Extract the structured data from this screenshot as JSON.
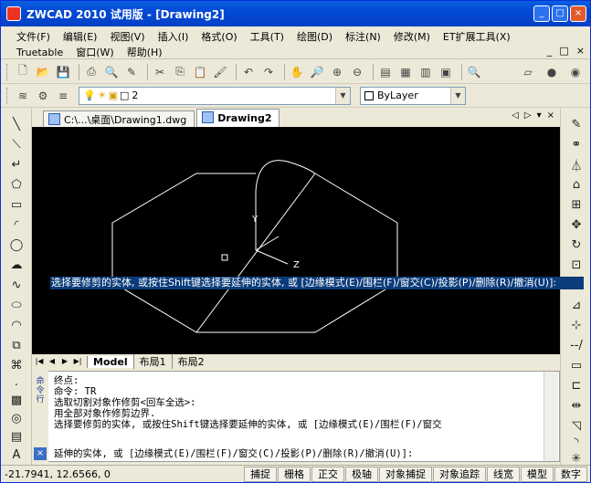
{
  "window": {
    "title": "ZWCAD 2010 试用版 - [Drawing2]"
  },
  "menu": {
    "row1": [
      "文件(F)",
      "编辑(E)",
      "视图(V)",
      "插入(I)",
      "格式(O)",
      "工具(T)",
      "绘图(D)",
      "标注(N)",
      "修改(M)",
      "ET扩展工具(X)"
    ],
    "row2": [
      "Truetable",
      "窗口(W)",
      "帮助(H)"
    ],
    "doc_controls": [
      "_",
      "□",
      "×"
    ]
  },
  "toolbar": {
    "layer_value": "2",
    "linetype_value": "ByLayer"
  },
  "doc_tabs": [
    {
      "label": "C:\\...\\桌面\\Drawing1.dwg",
      "active": false
    },
    {
      "label": "Drawing2",
      "active": true
    }
  ],
  "doc_tab_controls": [
    "◁",
    "▷",
    "▾",
    "×"
  ],
  "canvas": {
    "prompt_highlight": "选择要修剪的实体, 或按住Shift键选择要延伸的实体, 或 [边缘模式(E)/围栏(F)/窗交(C)/投影(P)/删除(R)/撤消(U)]:",
    "axis_labels": {
      "y": "Y",
      "z": "Z"
    }
  },
  "layout_tabs": {
    "nav": [
      "|◀",
      "◀",
      "▶",
      "▶|"
    ],
    "tabs": [
      "Model",
      "布局1",
      "布局2"
    ]
  },
  "command": {
    "side_label": "命令行",
    "lines": [
      "终点:",
      "命令: TR",
      "选取切割对象作修剪<回车全选>:",
      "用全部对象作修剪边界.",
      "选择要修剪的实体, 或按住Shift键选择要延伸的实体, 或 [边缘模式(E)/围栏(F)/窗交"
    ],
    "input_line": "延伸的实体, 或 [边缘模式(E)/围栏(F)/窗交(C)/投影(P)/删除(R)/撤消(U)]:"
  },
  "status": {
    "coords": "-21.7941, 12.6566, 0",
    "toggles": [
      "捕捉",
      "栅格",
      "正交",
      "极轴",
      "对象捕捉",
      "对象追踪",
      "线宽",
      "模型",
      "数字"
    ]
  }
}
